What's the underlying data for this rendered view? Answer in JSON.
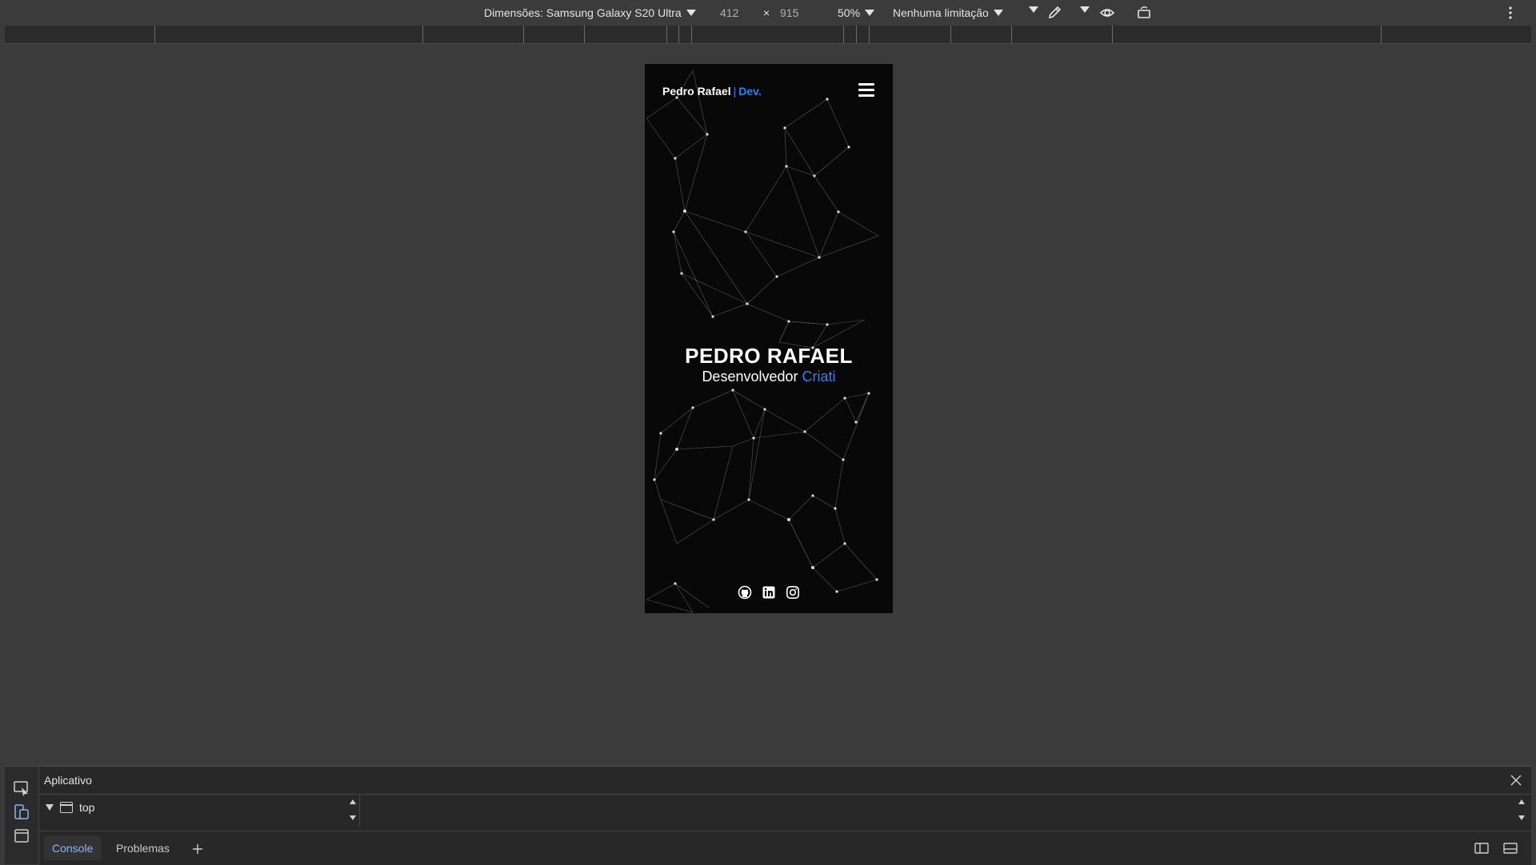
{
  "toolbar": {
    "dimensions_label": "Dimensões: Samsung Galaxy S20 Ultra",
    "width": "412",
    "times": "×",
    "height": "915",
    "zoom": "50%",
    "throttling": "Nenhuma limitação",
    "icons": [
      "chevron-down-icon",
      "eyedropper-icon",
      "eye-icon",
      "rotate-icon",
      "more-vert-icon"
    ]
  },
  "page": {
    "brand_name": "Pedro Rafael",
    "brand_sep": "|",
    "brand_suffix": "Dev.",
    "hero_name": "PEDRO RAFAEL",
    "hero_role_prefix": "Desenvolvedor",
    "hero_role_accent": "Criati",
    "socials": [
      "github-icon",
      "linkedin-icon",
      "instagram-icon"
    ],
    "colors": {
      "background": "#080808",
      "accent": "#2f7fff",
      "text": "#ffffff"
    }
  },
  "drawer": {
    "title": "Aplicativo",
    "tree_item": "top",
    "tabs": [
      {
        "label": "Console",
        "active": true
      },
      {
        "label": "Problemas",
        "active": false
      }
    ]
  }
}
